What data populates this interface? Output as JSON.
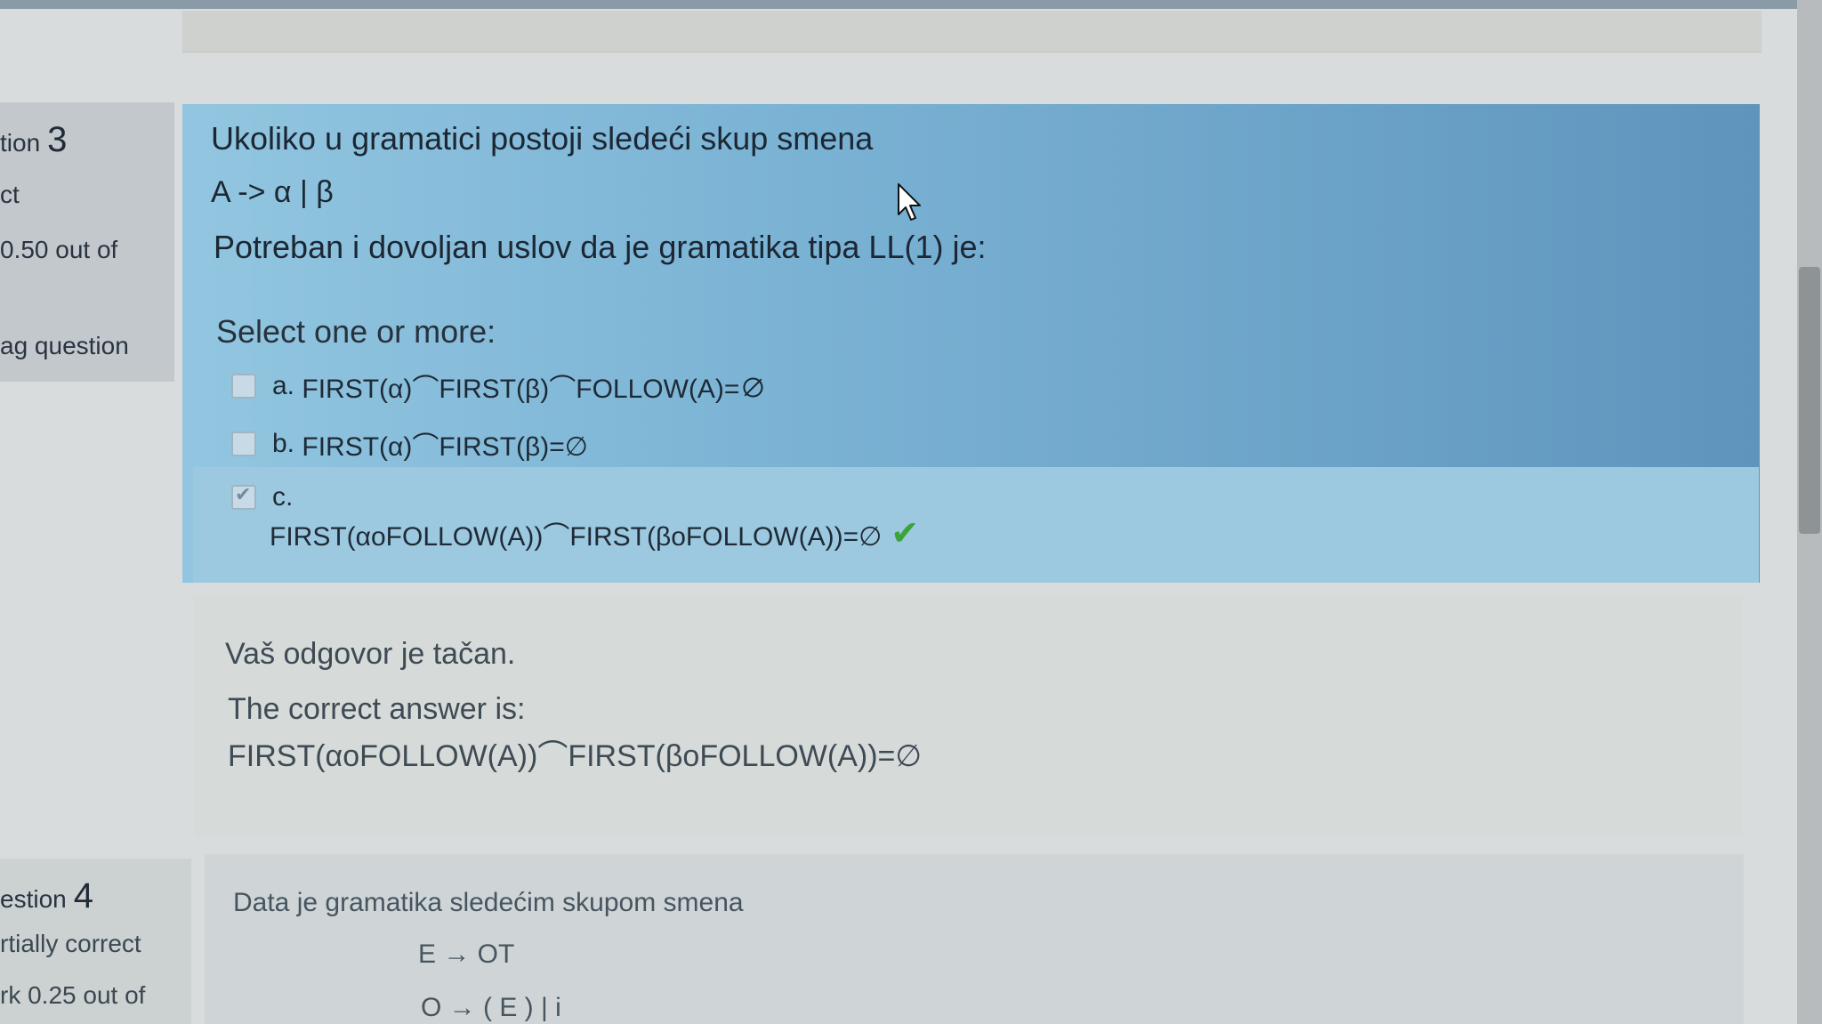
{
  "question3": {
    "number_prefix": "tion",
    "number": "3",
    "status": "ct",
    "mark": "0.50 out of",
    "flag": "ag question",
    "text_line1": "Ukoliko u gramatici postoji sledeći skup smena",
    "text_line2": "A -> α | β",
    "text_line3": "Potreban i dovoljan uslov da je gramatika tipa LL(1) je:",
    "prompt": "Select one or more:",
    "options": [
      {
        "letter": "a.",
        "text": "FIRST(α)⌒FIRST(β)⌒FOLLOW(A)=∅",
        "checked": false
      },
      {
        "letter": "b.",
        "text": "FIRST(α)⌒FIRST(β)=∅",
        "checked": false
      },
      {
        "letter": "c.",
        "text": "FIRST(αoFOLLOW(A))⌒FIRST(βoFOLLOW(A))=∅",
        "checked": true
      }
    ],
    "correct_mark": "✔"
  },
  "feedback": {
    "result": "Vaš odgovor je tačan.",
    "correct_label": "The correct answer is:",
    "correct_value": "FIRST(αoFOLLOW(A))⌒FIRST(βoFOLLOW(A))=∅"
  },
  "question4": {
    "number_prefix": "estion",
    "number": "4",
    "status": "rtially correct",
    "mark": "rk 0.25 out of",
    "text_line1": "Data je gramatika sledećim skupom smena",
    "rule1": "E → OT",
    "rule2": "O → ( E ) | i"
  },
  "colors": {
    "question_bg": "#7ab2d4",
    "info_bg": "#c3c8cc",
    "feedback_bg": "#d6dad8",
    "correct_tick": "#3aa43a"
  }
}
